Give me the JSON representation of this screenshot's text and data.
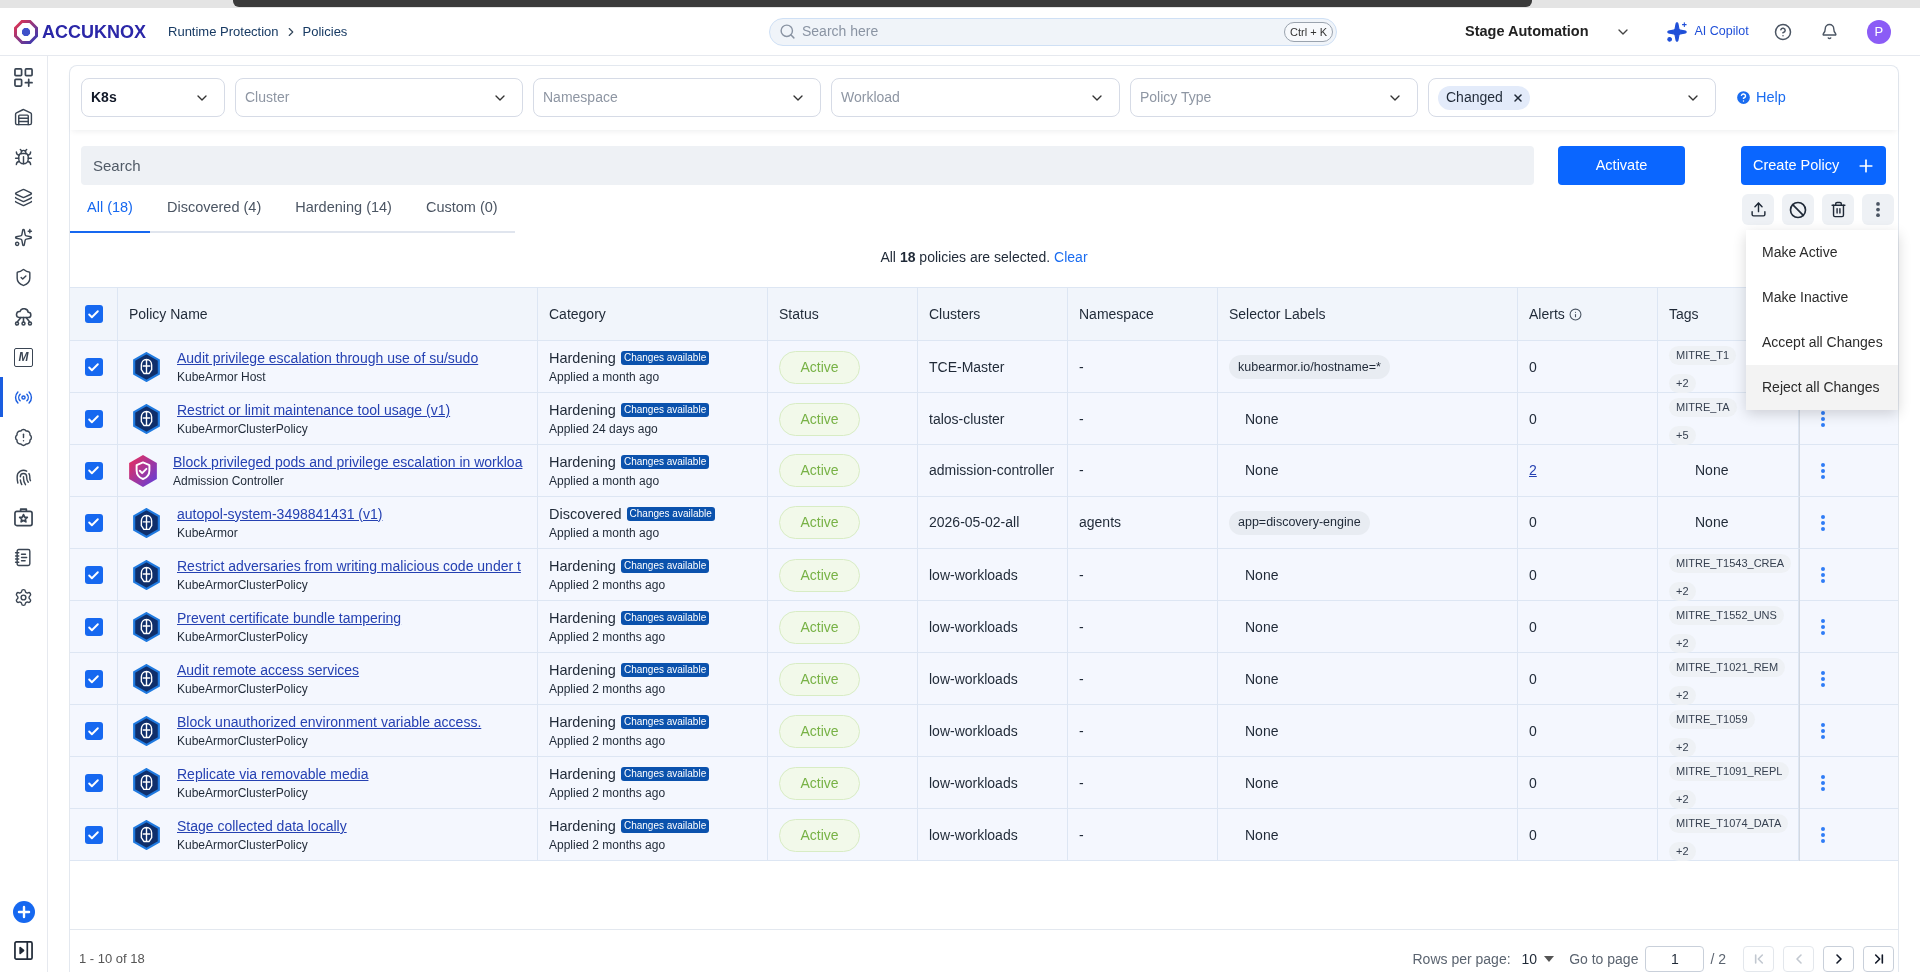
{
  "topbar": {
    "logo": "ACCUKNOX",
    "breadcrumb": [
      "Runtime Protection",
      "Policies"
    ],
    "search": {
      "placeholder": "Search here",
      "shortcut": "Ctrl + K"
    },
    "workspace": "Stage Automation",
    "copilot": "AI Copilot",
    "avatar": "P"
  },
  "sidebar": {
    "items": [
      {
        "selected": false
      },
      {
        "selected": false
      },
      {
        "selected": false
      },
      {
        "selected": false
      },
      {
        "selected": false
      },
      {
        "selected": false
      },
      {
        "selected": false
      },
      {
        "selected": false,
        "glyph": "M"
      },
      {
        "selected": true
      },
      {
        "selected": false
      },
      {
        "selected": false
      },
      {
        "selected": false
      },
      {
        "selected": false
      },
      {
        "selected": false
      }
    ]
  },
  "filters": [
    {
      "kind": "select",
      "value": "K8s"
    },
    {
      "kind": "select",
      "placeholder": "Cluster"
    },
    {
      "kind": "select",
      "placeholder": "Namespace"
    },
    {
      "kind": "select",
      "placeholder": "Workload"
    },
    {
      "kind": "select",
      "placeholder": "Policy Type"
    },
    {
      "kind": "chips",
      "chips": [
        "Changed"
      ]
    }
  ],
  "help": "Help",
  "search": {
    "placeholder": "Search"
  },
  "activate": "Activate",
  "create_policy": "Create Policy",
  "tabs": [
    {
      "label": "All (18)",
      "selected": true
    },
    {
      "label": "Discovered (4)",
      "selected": false
    },
    {
      "label": "Hardening (14)",
      "selected": false
    },
    {
      "label": "Custom (0)",
      "selected": false
    }
  ],
  "action_menu": {
    "open": true,
    "items": [
      {
        "label": "Make Active",
        "highlighted": false
      },
      {
        "label": "Make Inactive",
        "highlighted": false
      },
      {
        "label": "Accept all Changes",
        "highlighted": false
      },
      {
        "label": "Reject all Changes",
        "highlighted": true
      }
    ]
  },
  "selection_banner": {
    "message": "All **18** policies are selected.",
    "link": "Clear"
  },
  "table": {
    "all_selected": true,
    "columns": [
      {
        "label": "Policy Name"
      },
      {
        "label": "Category"
      },
      {
        "label": "Status"
      },
      {
        "label": "Clusters"
      },
      {
        "label": "Namespace"
      },
      {
        "label": "Selector Labels"
      },
      {
        "label": "Alerts",
        "info": true
      },
      {
        "label": "Tags"
      }
    ],
    "rows": [
      {
        "selected": true,
        "kind": "kubearmor",
        "name": "Audit privilege escalation through use of su/sudo",
        "type": "KubeArmor Host",
        "category": "Hardening",
        "badge": "Changes available",
        "applied": "Applied a month ago",
        "status": "Active",
        "cluster": "TCE-Master",
        "namespace": "-",
        "selector": {
          "kind": "chip",
          "text": "kubearmor.io/hostname=*"
        },
        "alerts": {
          "text": "0",
          "link": false
        },
        "tags": {
          "kind": "chips",
          "items": [
            "MITRE_T1"
          ],
          "more": "+2"
        }
      },
      {
        "selected": true,
        "kind": "kubearmor",
        "name": "Restrict or limit maintenance tool usage (v1)",
        "type": "KubeArmorClusterPolicy",
        "category": "Hardening",
        "badge": "Changes available",
        "applied": "Applied 24 days ago",
        "status": "Active",
        "cluster": "talos-cluster",
        "namespace": "-",
        "selector": {
          "kind": "plain",
          "text": "None"
        },
        "alerts": {
          "text": "0",
          "link": false
        },
        "tags": {
          "kind": "chips",
          "items": [
            "MITRE_TA"
          ],
          "more": "+5"
        }
      },
      {
        "selected": true,
        "kind": "admission",
        "name": "Block privileged pods and privilege escalation in workloa",
        "type": "Admission Controller",
        "category": "Hardening",
        "badge": "Changes available",
        "applied": "Applied a month ago",
        "status": "Active",
        "cluster": "admission-controller",
        "namespace": "-",
        "selector": {
          "kind": "plain",
          "text": "None"
        },
        "alerts": {
          "text": "2",
          "link": true
        },
        "tags": {
          "kind": "none",
          "text": "None"
        }
      },
      {
        "selected": true,
        "kind": "kubearmor",
        "name": "autopol-system-3498841431 (v1)",
        "type": "KubeArmor",
        "category": "Discovered",
        "badge": "Changes available",
        "applied": "Applied a month ago",
        "status": "Active",
        "cluster": "2026-05-02-all",
        "namespace": "agents",
        "selector": {
          "kind": "chip",
          "text": "app=discovery-engine"
        },
        "alerts": {
          "text": "0",
          "link": false
        },
        "tags": {
          "kind": "none",
          "text": "None"
        }
      },
      {
        "selected": true,
        "kind": "kubearmor",
        "name": "Restrict adversaries from writing malicious code under t",
        "type": "KubeArmorClusterPolicy",
        "category": "Hardening",
        "badge": "Changes available",
        "applied": "Applied 2 months ago",
        "status": "Active",
        "cluster": "low-workloads",
        "namespace": "-",
        "selector": {
          "kind": "plain",
          "text": "None"
        },
        "alerts": {
          "text": "0",
          "link": false
        },
        "tags": {
          "kind": "chips",
          "items": [
            "MITRE_T1543_CREA"
          ],
          "more": "+2"
        }
      },
      {
        "selected": true,
        "kind": "kubearmor",
        "name": "Prevent certificate bundle tampering",
        "type": "KubeArmorClusterPolicy",
        "category": "Hardening",
        "badge": "Changes available",
        "applied": "Applied 2 months ago",
        "status": "Active",
        "cluster": "low-workloads",
        "namespace": "-",
        "selector": {
          "kind": "plain",
          "text": "None"
        },
        "alerts": {
          "text": "0",
          "link": false
        },
        "tags": {
          "kind": "chips",
          "items": [
            "MITRE_T1552_UNS"
          ],
          "more": "+2"
        }
      },
      {
        "selected": true,
        "kind": "kubearmor",
        "name": "Audit remote access services",
        "type": "KubeArmorClusterPolicy",
        "category": "Hardening",
        "badge": "Changes available",
        "applied": "Applied 2 months ago",
        "status": "Active",
        "cluster": "low-workloads",
        "namespace": "-",
        "selector": {
          "kind": "plain",
          "text": "None"
        },
        "alerts": {
          "text": "0",
          "link": false
        },
        "tags": {
          "kind": "chips",
          "items": [
            "MITRE_T1021_REM"
          ],
          "more": "+2"
        }
      },
      {
        "selected": true,
        "kind": "kubearmor",
        "name": "Block unauthorized environment variable access.",
        "type": "KubeArmorClusterPolicy",
        "category": "Hardening",
        "badge": "Changes available",
        "applied": "Applied 2 months ago",
        "status": "Active",
        "cluster": "low-workloads",
        "namespace": "-",
        "selector": {
          "kind": "plain",
          "text": "None"
        },
        "alerts": {
          "text": "0",
          "link": false
        },
        "tags": {
          "kind": "chips",
          "items": [
            "MITRE_T1059"
          ],
          "more": "+2"
        }
      },
      {
        "selected": true,
        "kind": "kubearmor",
        "name": "Replicate via removable media",
        "type": "KubeArmorClusterPolicy",
        "category": "Hardening",
        "badge": "Changes available",
        "applied": "Applied 2 months ago",
        "status": "Active",
        "cluster": "low-workloads",
        "namespace": "-",
        "selector": {
          "kind": "plain",
          "text": "None"
        },
        "alerts": {
          "text": "0",
          "link": false
        },
        "tags": {
          "kind": "chips",
          "items": [
            "MITRE_T1091_REPL"
          ],
          "more": "+2"
        }
      },
      {
        "selected": true,
        "kind": "kubearmor",
        "name": "Stage collected data locally",
        "type": "KubeArmorClusterPolicy",
        "category": "Hardening",
        "badge": "Changes available",
        "applied": "Applied 2 months ago",
        "status": "Active",
        "cluster": "low-workloads",
        "namespace": "-",
        "selector": {
          "kind": "plain",
          "text": "None"
        },
        "alerts": {
          "text": "0",
          "link": false
        },
        "tags": {
          "kind": "chips",
          "items": [
            "MITRE_T1074_DATA"
          ],
          "more": "+2"
        }
      }
    ]
  },
  "pagination": {
    "range": "1 - 10 of 18",
    "rows_label": "Rows per page:",
    "rows_value": "10",
    "goto_label": "Go to page",
    "page": "1",
    "page_total": "/ 2",
    "first_disabled": true,
    "prev_disabled": true,
    "next_disabled": false,
    "last_disabled": false
  }
}
